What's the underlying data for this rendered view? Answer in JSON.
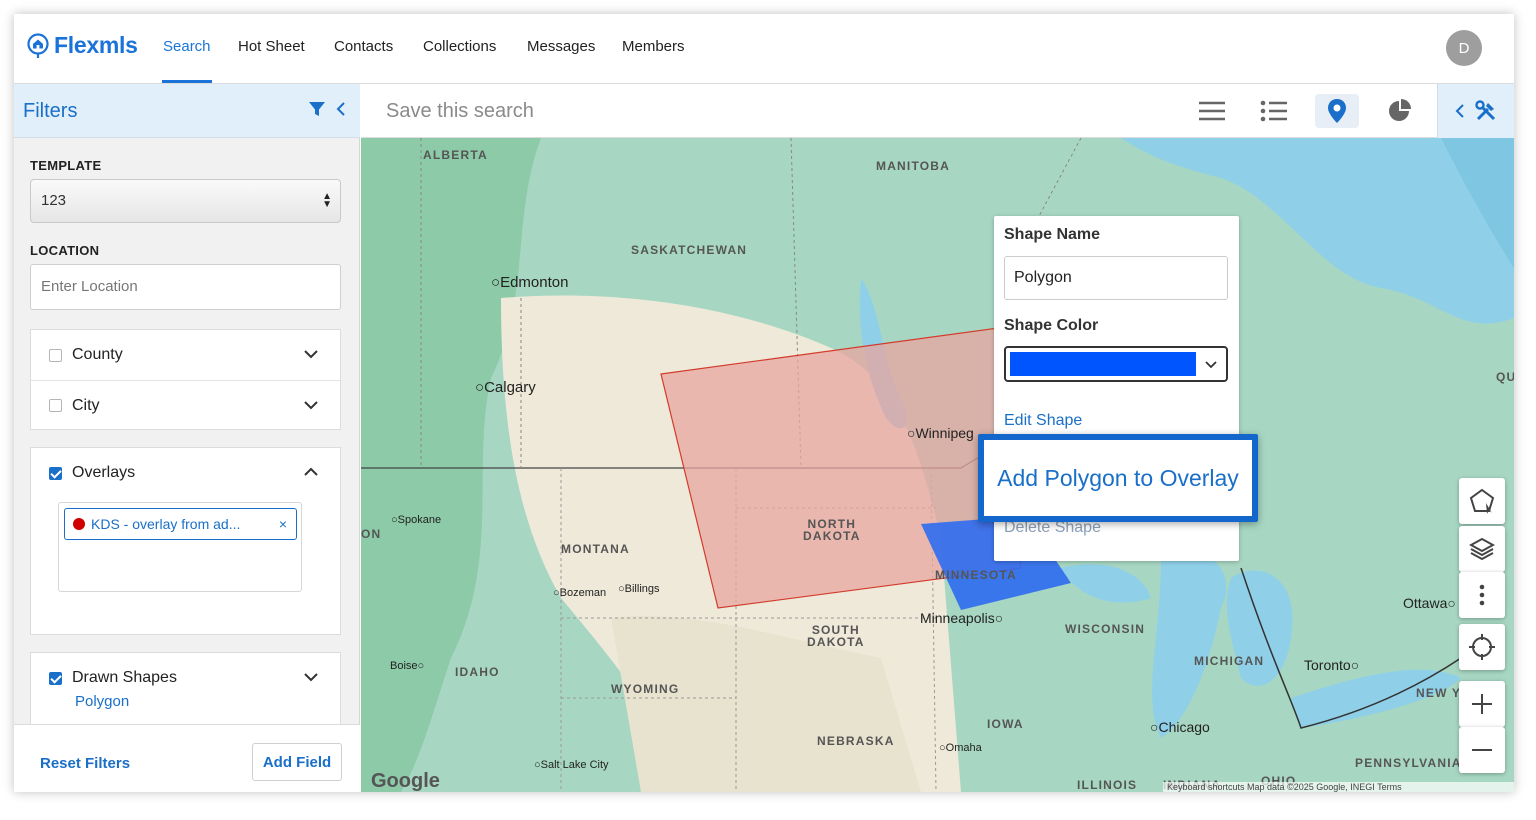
{
  "app": {
    "logo_text": "Flexmls",
    "avatar_initial": "D"
  },
  "nav": {
    "items": [
      "Search",
      "Hot Sheet",
      "Contacts",
      "Collections",
      "Messages",
      "Members"
    ]
  },
  "sidebar": {
    "title": "Filters",
    "template_label": "TEMPLATE",
    "template_value": "123",
    "location_label": "LOCATION",
    "location_placeholder": "Enter Location",
    "county_label": "County",
    "city_label": "City",
    "overlays_label": "Overlays",
    "overlay_tag": "KDS - overlay from ad...",
    "overlay_tag_remove": "×",
    "drawn_shapes_label": "Drawn Shapes",
    "drawn_shapes_value": "Polygon",
    "reset_label": "Reset Filters",
    "add_field_label": "Add Field"
  },
  "toolbar": {
    "save_search_placeholder": "Save this search"
  },
  "map": {
    "labels": {
      "alberta": "ALBERTA",
      "manitoba": "MANITOBA",
      "saskatchewan": "SASKATCHEWAN",
      "north_dakota": "NORTH\nDAKOTA",
      "montana": "MONTANA",
      "south_dakota": "SOUTH\nDAKOTA",
      "minnesota": "MINNESOTA",
      "wisconsin": "WISCONSIN",
      "michigan": "MICHIGAN",
      "idaho": "IDAHO",
      "wyoming": "WYOMING",
      "iowa": "IOWA",
      "nebraska": "NEBRASKA",
      "illinois": "ILLINOIS",
      "indiana": "INDIANA",
      "ohio": "OHIO",
      "pennsylvania": "PENNSYLVANIA",
      "new_york": "NEW Y",
      "qu": "QU",
      "on": "ON"
    },
    "cities": {
      "edmonton": "Edmonton",
      "calgary": "Calgary",
      "winnipeg": "Winnipeg",
      "spokane": "Spokane",
      "bozeman": "Bozeman",
      "billings": "Billings",
      "minneapolis": "Minneapolis",
      "boise": "Boise",
      "chicago": "Chicago",
      "omaha": "Omaha",
      "salt_lake": "Salt Lake City",
      "toronto": "Toronto",
      "ottawa": "Ottawa"
    },
    "google": "Google",
    "attribution": "Keyboard shortcuts   Map data ©2025 Google, INEGI   Terms"
  },
  "shape_panel": {
    "name_label": "Shape Name",
    "name_value": "Polygon",
    "color_label": "Shape Color",
    "color_value": "#0055ff",
    "edit_label": "Edit Shape",
    "add_overlay_label": "Add Polygon to Overlay",
    "delete_label": "Delete Shape"
  },
  "colors": {
    "brand": "#1a6fc8",
    "polygon_fill": "#e8a6a0",
    "overlay_fill": "#2f6bf0"
  }
}
